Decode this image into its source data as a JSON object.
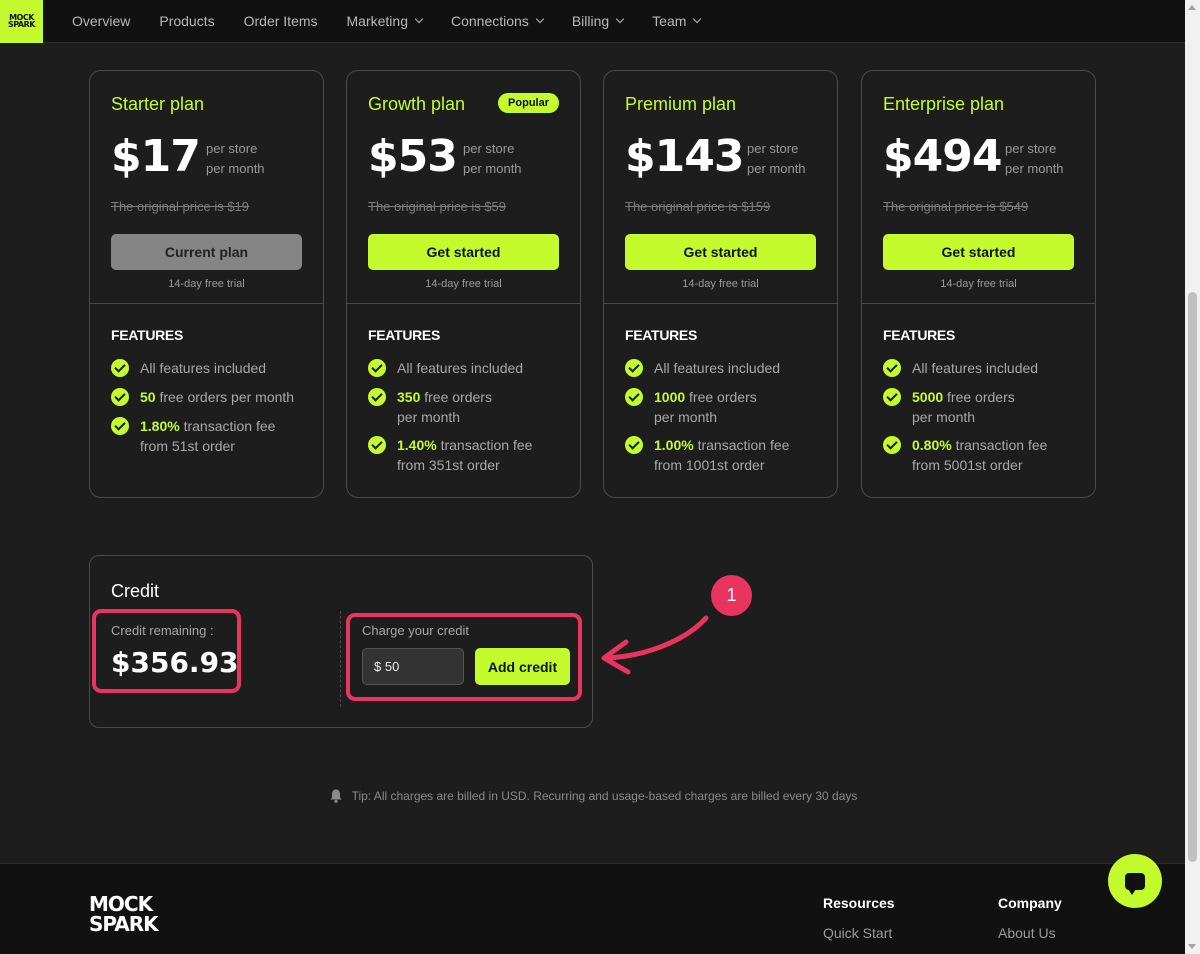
{
  "nav": {
    "logo_lines": [
      "MOCK",
      "SPARK"
    ],
    "items": [
      {
        "label": "Overview",
        "dropdown": false
      },
      {
        "label": "Products",
        "dropdown": false
      },
      {
        "label": "Order Items",
        "dropdown": false
      },
      {
        "label": "Marketing",
        "dropdown": true
      },
      {
        "label": "Connections",
        "dropdown": true
      },
      {
        "label": "Billing",
        "dropdown": true
      },
      {
        "label": "Team",
        "dropdown": true
      }
    ]
  },
  "plans": [
    {
      "name": "Starter plan",
      "badge": "",
      "price": "$17",
      "per_line1": "per store",
      "per_line2": "per month",
      "original": "The original price is $19",
      "button": "Current plan",
      "trial": "14-day free trial",
      "features_title": "FEATURES",
      "f1": "All features included",
      "f2_hl": "50",
      "f2_rest": "free orders per month",
      "f3_hl": "1.80%",
      "f3_rest": "transaction fee",
      "f3_line2": "from 51st order"
    },
    {
      "name": "Growth plan",
      "badge": "Popular",
      "price": "$53",
      "per_line1": "per store",
      "per_line2": "per month",
      "original": "The original price is $59",
      "button": "Get started",
      "trial": "14-day free trial",
      "features_title": "FEATURES",
      "f1": "All features included",
      "f2_hl": "350",
      "f2_rest": "free orders",
      "f2_line2": "per month",
      "f3_hl": "1.40%",
      "f3_rest": "transaction fee",
      "f3_line2": "from 351st order"
    },
    {
      "name": "Premium plan",
      "badge": "",
      "price": "$143",
      "per_line1": "per store",
      "per_line2": "per month",
      "original": "The original price is $159",
      "button": "Get started",
      "trial": "14-day free trial",
      "features_title": "FEATURES",
      "f1": "All features included",
      "f2_hl": "1000",
      "f2_rest": "free orders",
      "f2_line2": "per month",
      "f3_hl": "1.00%",
      "f3_rest": "transaction fee",
      "f3_line2": "from 1001st order"
    },
    {
      "name": "Enterprise plan",
      "badge": "",
      "price": "$494",
      "per_line1": "per store",
      "per_line2": "per month",
      "original": "The original price is $549",
      "button": "Get started",
      "trial": "14-day free trial",
      "features_title": "FEATURES",
      "f1": "All features included",
      "f2_hl": "5000",
      "f2_rest": "free orders",
      "f2_line2": "per month",
      "f3_hl": "0.80%",
      "f3_rest": "transaction fee",
      "f3_line2": "from 5001st order"
    }
  ],
  "credit": {
    "title": "Credit",
    "remaining_label": "Credit remaining :",
    "remaining_value": "$356.93",
    "charge_label": "Charge your credit",
    "input_value": "$ 50",
    "add_button": "Add credit"
  },
  "annotation": {
    "number": "1",
    "color": "#e8345f"
  },
  "tip": "Tip: All charges are billed in USD. Recurring and usage-based charges are billed every 30 days",
  "footer": {
    "logo_lines": [
      "MOCK",
      "SPARK"
    ],
    "resources_title": "Resources",
    "resources_link": "Quick Start",
    "company_title": "Company",
    "company_link": "About Us"
  },
  "colors": {
    "accent": "#c4fb2d",
    "background": "#1d1d1d",
    "highlight": "#e8345f"
  }
}
